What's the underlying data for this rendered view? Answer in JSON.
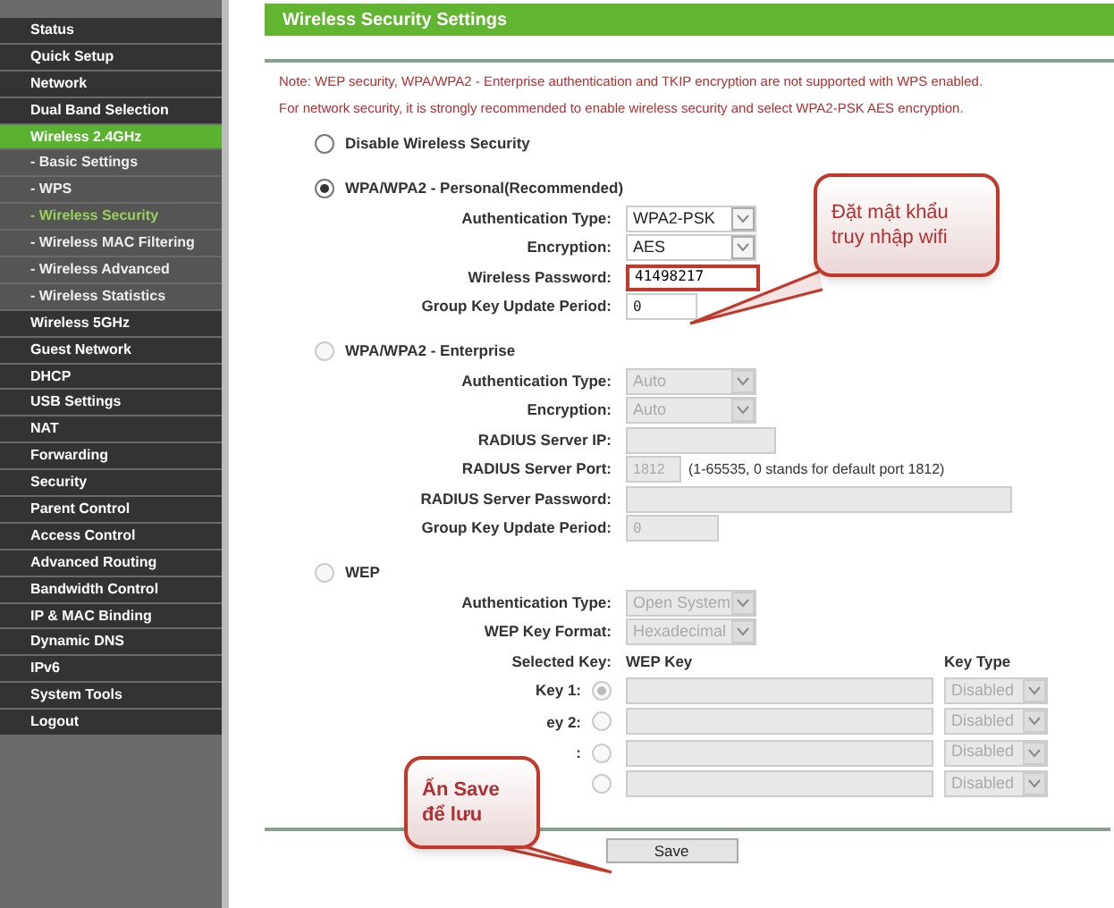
{
  "sidebar": {
    "items": [
      {
        "label": "Status",
        "kind": "main",
        "selected": false
      },
      {
        "label": "Quick Setup",
        "kind": "main",
        "selected": false
      },
      {
        "label": "Network",
        "kind": "main",
        "selected": false
      },
      {
        "label": "Dual Band Selection",
        "kind": "main",
        "selected": false
      },
      {
        "label": "Wireless 2.4GHz",
        "kind": "main",
        "selected": true
      },
      {
        "label": "- Basic Settings",
        "kind": "sub",
        "selected": false
      },
      {
        "label": "- WPS",
        "kind": "sub",
        "selected": false
      },
      {
        "label": "- Wireless Security",
        "kind": "sub",
        "selected": true
      },
      {
        "label": "- Wireless MAC Filtering",
        "kind": "sub",
        "selected": false
      },
      {
        "label": "- Wireless Advanced",
        "kind": "sub",
        "selected": false
      },
      {
        "label": "- Wireless Statistics",
        "kind": "sub",
        "selected": false
      },
      {
        "label": "Wireless 5GHz",
        "kind": "main",
        "selected": false
      },
      {
        "label": "Guest Network",
        "kind": "main",
        "selected": false
      },
      {
        "label": "DHCP",
        "kind": "main",
        "selected": false
      },
      {
        "label": "USB Settings",
        "kind": "main",
        "selected": false
      },
      {
        "label": "NAT",
        "kind": "main",
        "selected": false
      },
      {
        "label": "Forwarding",
        "kind": "main",
        "selected": false
      },
      {
        "label": "Security",
        "kind": "main",
        "selected": false
      },
      {
        "label": "Parent Control",
        "kind": "main",
        "selected": false
      },
      {
        "label": "Access Control",
        "kind": "main",
        "selected": false
      },
      {
        "label": "Advanced Routing",
        "kind": "main",
        "selected": false
      },
      {
        "label": "Bandwidth Control",
        "kind": "main",
        "selected": false
      },
      {
        "label": "IP & MAC Binding",
        "kind": "main",
        "selected": false
      },
      {
        "label": "Dynamic DNS",
        "kind": "main",
        "selected": false
      },
      {
        "label": "IPv6",
        "kind": "main",
        "selected": false
      },
      {
        "label": "System Tools",
        "kind": "main",
        "selected": false
      },
      {
        "label": "Logout",
        "kind": "main",
        "selected": false
      }
    ]
  },
  "title": "Wireless Security Settings",
  "notes": [
    "Note: WEP security, WPA/WPA2 - Enterprise authentication and TKIP encryption are not supported with WPS enabled.",
    "For network security, it is strongly recommended to enable wireless security and select WPA2-PSK AES encryption."
  ],
  "sections": [
    {
      "label": "Disable Wireless Security",
      "selected": false,
      "disabled": false
    },
    {
      "label": "WPA/WPA2 - Personal(Recommended)",
      "selected": true,
      "disabled": false,
      "rows": [
        {
          "kind": "select",
          "label": "Authentication Type:",
          "value": "WPA2-PSK"
        },
        {
          "kind": "select",
          "label": "Encryption:",
          "value": "AES"
        },
        {
          "kind": "field",
          "label": "Wireless Password:",
          "value": "41498217",
          "highlighted": true
        },
        {
          "kind": "field",
          "label": "Group Key Update Period:",
          "value": "0",
          "highlighted": false
        }
      ]
    },
    {
      "label": "WPA/WPA2 - Enterprise",
      "selected": false,
      "disabled": true,
      "rows": [
        {
          "kind": "select",
          "label": "Authentication Type:",
          "value": "Auto"
        },
        {
          "kind": "select",
          "label": "Encryption:",
          "value": "Auto"
        },
        {
          "kind": "field",
          "label": "RADIUS Server IP:",
          "highlighted": false
        },
        {
          "kind": "port",
          "label": "RADIUS Server Port:",
          "value": "1812",
          "hint": "(1-65535, 0 stands for default port 1812)"
        },
        {
          "kind": "widefield",
          "label": "RADIUS Server Password:"
        },
        {
          "kind": "field",
          "label": "Group Key Update Period:",
          "value": "0",
          "highlighted": false
        }
      ]
    },
    {
      "label": "WEP",
      "selected": false,
      "disabled": true,
      "rows": [
        {
          "kind": "select",
          "label": "Authentication Type:",
          "value": "Open System"
        },
        {
          "kind": "select",
          "label": "WEP Key Format:",
          "value": "Hexadecimal"
        }
      ]
    }
  ],
  "wep_keys": {
    "headers": [
      "Selected Key:",
      "WEP Key",
      "Key Type"
    ],
    "keys": [
      {
        "label": "Key 1:",
        "selected": true,
        "type": "Disabled"
      },
      {
        "label": "ey 2:",
        "selected": false,
        "type": "Disabled"
      },
      {
        "label": ":",
        "selected": false,
        "type": "Disabled"
      },
      {
        "selected": false,
        "type": "Disabled"
      }
    ]
  },
  "save_button": "Save",
  "callouts": [
    {
      "text": "Đặt mật khẩu truy nhập wifi"
    },
    {
      "text": "Ấn Save để lưu"
    }
  ]
}
